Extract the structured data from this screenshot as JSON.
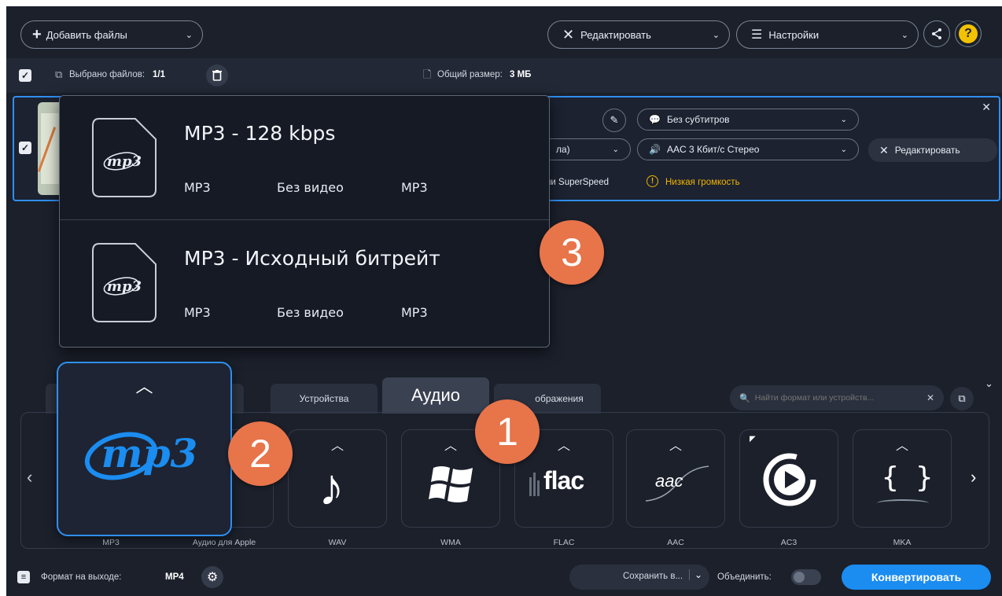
{
  "toolbar": {
    "add_files": "Добавить файлы",
    "edit": "Редактировать",
    "settings": "Настройки",
    "help": "?"
  },
  "filesbar": {
    "selected_label": "Выбрано файлов:",
    "selected_value": "1/1",
    "total_label": "Общий размер:",
    "total_value": "3 МБ"
  },
  "file_item": {
    "subtitles": "Без субтитров",
    "audio_track_tail": "ла)",
    "audio_codec": "AAC 3 Кбит/с Стерео",
    "edit_button": "Редактировать",
    "superspeed_tail": "ии SuperSpeed",
    "warning": "Низкая громкость"
  },
  "presets": [
    {
      "title": "MP3 - 128 kbps",
      "format": "MP3",
      "video": "Без видео",
      "audio": "MP3",
      "icon": "mp3"
    },
    {
      "title": "MP3 - Исходный битрейт",
      "format": "MP3",
      "video": "Без видео",
      "audio": "MP3",
      "icon": "mp3"
    }
  ],
  "tabs": {
    "devices": "Устройства",
    "audio": "Аудио",
    "images_tail": "ображения"
  },
  "search": {
    "placeholder": "Найти формат или устройств..."
  },
  "formats": [
    {
      "label": "MP3",
      "icon": "mp3-logo"
    },
    {
      "label": "Аудио для Apple",
      "icon": "apple-audio-icon",
      "partial": "io"
    },
    {
      "label": "WAV",
      "icon": "music-note-icon"
    },
    {
      "label": "WMA",
      "icon": "windows-icon"
    },
    {
      "label": "FLAC",
      "icon": "flac-icon",
      "text": "flac"
    },
    {
      "label": "AAC",
      "icon": "aac-icon",
      "text": "aac"
    },
    {
      "label": "AC3",
      "icon": "play-circle-icon"
    },
    {
      "label": "MKA",
      "icon": "braces-icon",
      "text": "{ }"
    }
  ],
  "mp3_featured": {
    "logo": "mp3"
  },
  "badges": [
    "1",
    "2",
    "3"
  ],
  "bottom": {
    "output_label": "Формат на выходе:",
    "output_value": "MP4",
    "save_to": "Сохранить в...",
    "merge": "Объединить:",
    "convert": "Конвертировать"
  },
  "colors": {
    "accent": "#2f8ff0",
    "badge": "#e8744a",
    "warning": "#f2b400",
    "convert": "#1b8cf0"
  }
}
